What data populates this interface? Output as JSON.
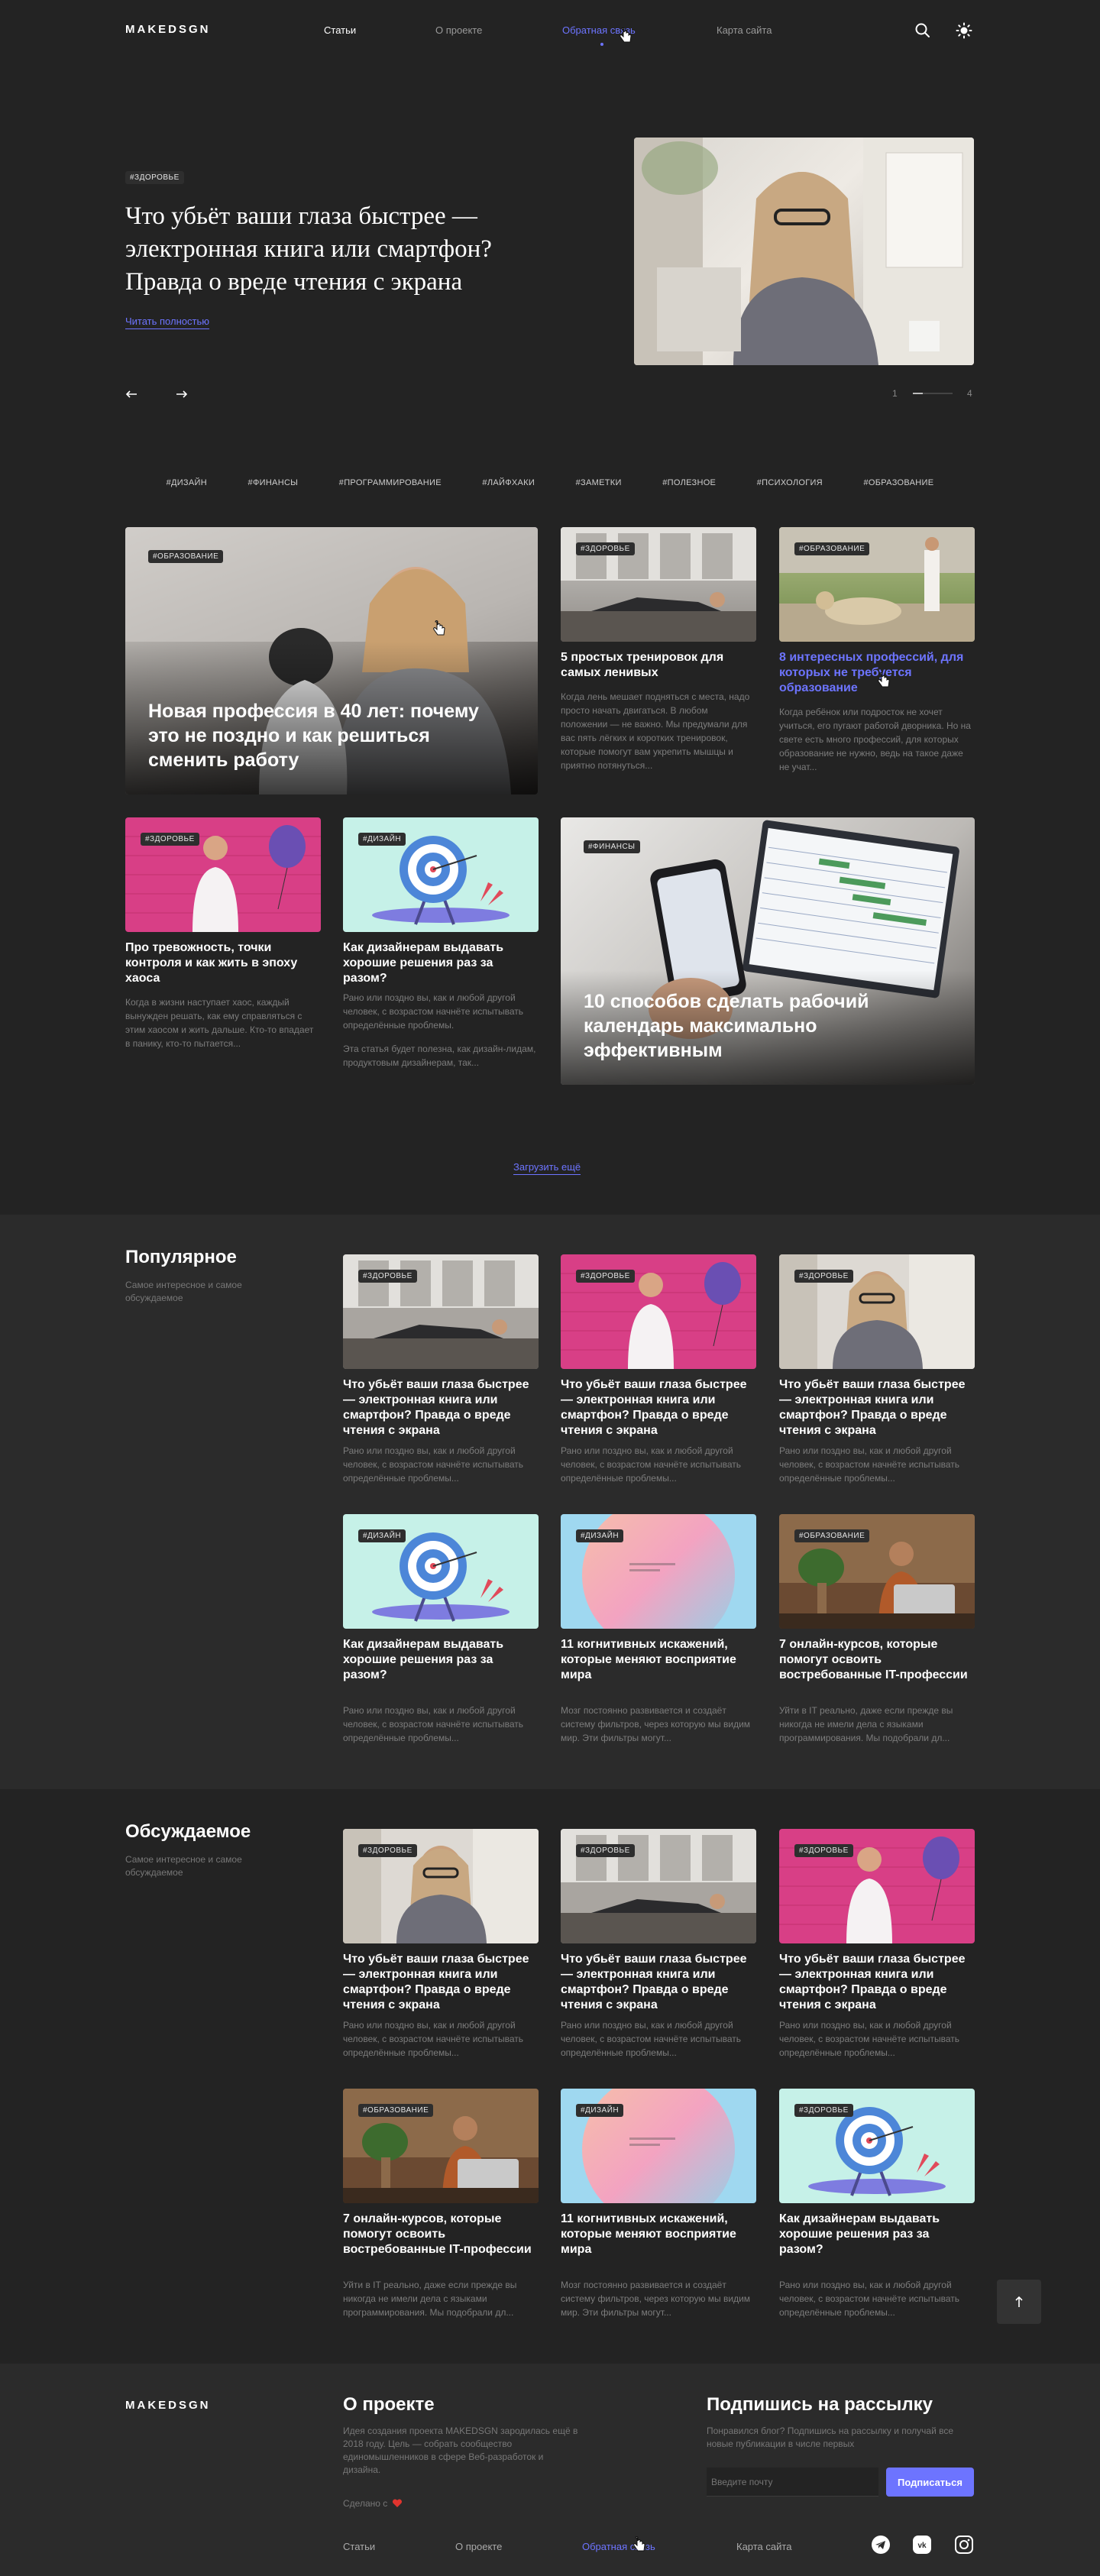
{
  "header": {
    "logo": "MAKEDSGN",
    "nav": [
      "Статьи",
      "О проекте",
      "Обратная связь",
      "Карта сайта"
    ]
  },
  "hero": {
    "tag": "#ЗДОРОВЬЕ",
    "title": "Что убьёт ваши глаза быстрее — электронная книга или смартфон? Правда о вреде чтения с экрана",
    "link": "Читать полностью",
    "pager_current": "1",
    "pager_total": "4",
    "progress": 0.25
  },
  "hashtags": [
    "#ДИЗАЙН",
    "#ФИНАНСЫ",
    "#ПРОГРАММИРОВАНИЕ",
    "#ЛАЙФХАКИ",
    "#ЗАМЕТКИ",
    "#ПОЛЕЗНОЕ",
    "#ПСИХОЛОГИЯ",
    "#ОБРАЗОВАНИЕ"
  ],
  "articles": {
    "big1": {
      "tag": "#ОБРАЗОВАНИЕ",
      "title": "Новая профессия в 40 лет: почему это не поздно и как решиться сменить работу"
    },
    "a1": {
      "tag": "#ЗДОРОВЬЕ",
      "title": "5 простых тренировок для самых ленивых",
      "text": "Когда лень мешает подняться с места, надо просто начать двигаться. В любом положении — не важно. Мы предумали для вас пять лёгких и коротких тренировок, которые помогут вам укрепить мышцы и приятно потянуться..."
    },
    "a2": {
      "tag": "#ОБРАЗОВАНИЕ",
      "title": "8 интересных профессий, для которых не требуется образование",
      "text": "Когда ребёнок или подросток не хочет учиться, его пугают работой дворника. Но на свете есть много профессий, для которых образование не нужно, ведь на такое даже не учат..."
    },
    "a3": {
      "tag": "#ЗДОРОВЬЕ",
      "title": "Про тревожность, точки контроля и как жить в эпоху хаоса",
      "text": "Когда в жизни наступает хаос, каждый вынужден решать, как ему справляться с этим хаосом и жить дальше. Кто-то впадает в панику, кто-то пытается..."
    },
    "a4": {
      "tag": "#ДИЗАЙН",
      "title": "Как дизайнерам выдавать хорошие решения раз за разом?",
      "text": "Рано или поздно вы, как и любой другой человек, с возрастом начнёте испытывать определённые проблемы.",
      "text2": "Эта статья будет полезна, как дизайн-лидам, продуктовым дизайнерам, так..."
    },
    "big2": {
      "tag": "#ФИНАНСЫ",
      "title": "10 способов сделать рабочий календарь максимально эффективным"
    }
  },
  "load_more": "Загрузить ещё",
  "popular": {
    "title": "Популярное",
    "subtitle": "Самое интересное и самое обсуждаемое",
    "cards": [
      {
        "tag": "#ЗДОРОВЬЕ",
        "title": "Что убьёт ваши глаза быстрее — электронная книга или смартфон? Правда о вреде чтения с экрана",
        "text": "Рано или поздно вы, как и любой другой человек, с возрастом начнёте испытывать определённые проблемы..."
      },
      {
        "tag": "#ЗДОРОВЬЕ",
        "title": "Что убьёт ваши глаза быстрее — электронная книга или смартфон? Правда о вреде чтения с экрана",
        "text": "Рано или поздно вы, как и любой другой человек, с возрастом начнёте испытывать определённые проблемы..."
      },
      {
        "tag": "#ЗДОРОВЬЕ",
        "title": "Что убьёт ваши глаза быстрее — электронная книга или смартфон? Правда о вреде чтения с экрана",
        "text": "Рано или поздно вы, как и любой другой человек, с возрастом начнёте испытывать определённые проблемы..."
      },
      {
        "tag": "#ДИЗАЙН",
        "title": "Как дизайнерам выдавать хорошие решения раз за разом?",
        "text": "Рано или поздно вы, как и любой другой человек, с возрастом начнёте испытывать определённые проблемы..."
      },
      {
        "tag": "#ДИЗАЙН",
        "title": "11 когнитивных искажений, которые меняют восприятие мира",
        "text": "Мозг постоянно развивается и создаёт систему фильтров, через которую мы видим мир. Эти фильтры могут..."
      },
      {
        "tag": "#ОБРАЗОВАНИЕ",
        "title": "7 онлайн-курсов, которые помогут освоить востребованные IT-профессии",
        "text": "Уйти в IT реально, даже если прежде вы никогда не имели дела с языками программирования. Мы подобрали дл..."
      }
    ]
  },
  "discussed": {
    "title": "Обсуждаемое",
    "subtitle": "Самое интересное и самое обсуждаемое",
    "cards": [
      {
        "tag": "#ЗДОРОВЬЕ",
        "title": "Что убьёт ваши глаза быстрее — электронная книга или смартфон? Правда о вреде чтения с экрана",
        "text": "Рано или поздно вы, как и любой другой человек, с возрастом начнёте испытывать определённые проблемы..."
      },
      {
        "tag": "#ЗДОРОВЬЕ",
        "title": "Что убьёт ваши глаза быстрее — электронная книга или смартфон? Правда о вреде чтения с экрана",
        "text": "Рано или поздно вы, как и любой другой человек, с возрастом начнёте испытывать определённые проблемы..."
      },
      {
        "tag": "#ЗДОРОВЬЕ",
        "title": "Что убьёт ваши глаза быстрее — электронная книга или смартфон? Правда о вреде чтения с экрана",
        "text": "Рано или поздно вы, как и любой другой человек, с возрастом начнёте испытывать определённые проблемы..."
      },
      {
        "tag": "#ОБРАЗОВАНИЕ",
        "title": "7 онлайн-курсов, которые помогут освоить востребованные IT-профессии",
        "text": "Уйти в IT реально, даже если прежде вы никогда не имели дела с языками программирования. Мы подобрали дл..."
      },
      {
        "tag": "#ДИЗАЙН",
        "title": "11 когнитивных искажений, которые меняют восприятие мира",
        "text": "Мозг постоянно развивается и создаёт систему фильтров, через которую мы видим мир. Эти фильтры могут..."
      },
      {
        "tag": "#ЗДОРОВЬЕ",
        "title": "Как дизайнерам выдавать хорошие решения раз за разом?",
        "text": "Рано или поздно вы, как и любой другой человек, с возрастом начнёте испытывать определённые проблемы..."
      }
    ]
  },
  "footer": {
    "logo": "MAKEDSGN",
    "about_title": "О проекте",
    "about_text": "Идея создания проекта MAKEDSGN зародилась ещё в 2018 году. Цель — собрать сообщество единомышленников в сфере Веб-разработок и дизайна.",
    "made_with": "Сделано с",
    "subscribe_title": "Подпишись на рассылку",
    "subscribe_text": "Понравился блог? Подпишись на рассылку и получай все новые публикации в числе первых",
    "email_placeholder": "Введите почту",
    "subscribe_button": "Подписаться",
    "nav": [
      "Статьи",
      "О проекте",
      "Обратная связь",
      "Карта сайта"
    ]
  },
  "colors": {
    "accent": "#6d74ff",
    "bg": "#232323",
    "bg_alt": "#2b2b2b",
    "heart": "#e0342e"
  }
}
